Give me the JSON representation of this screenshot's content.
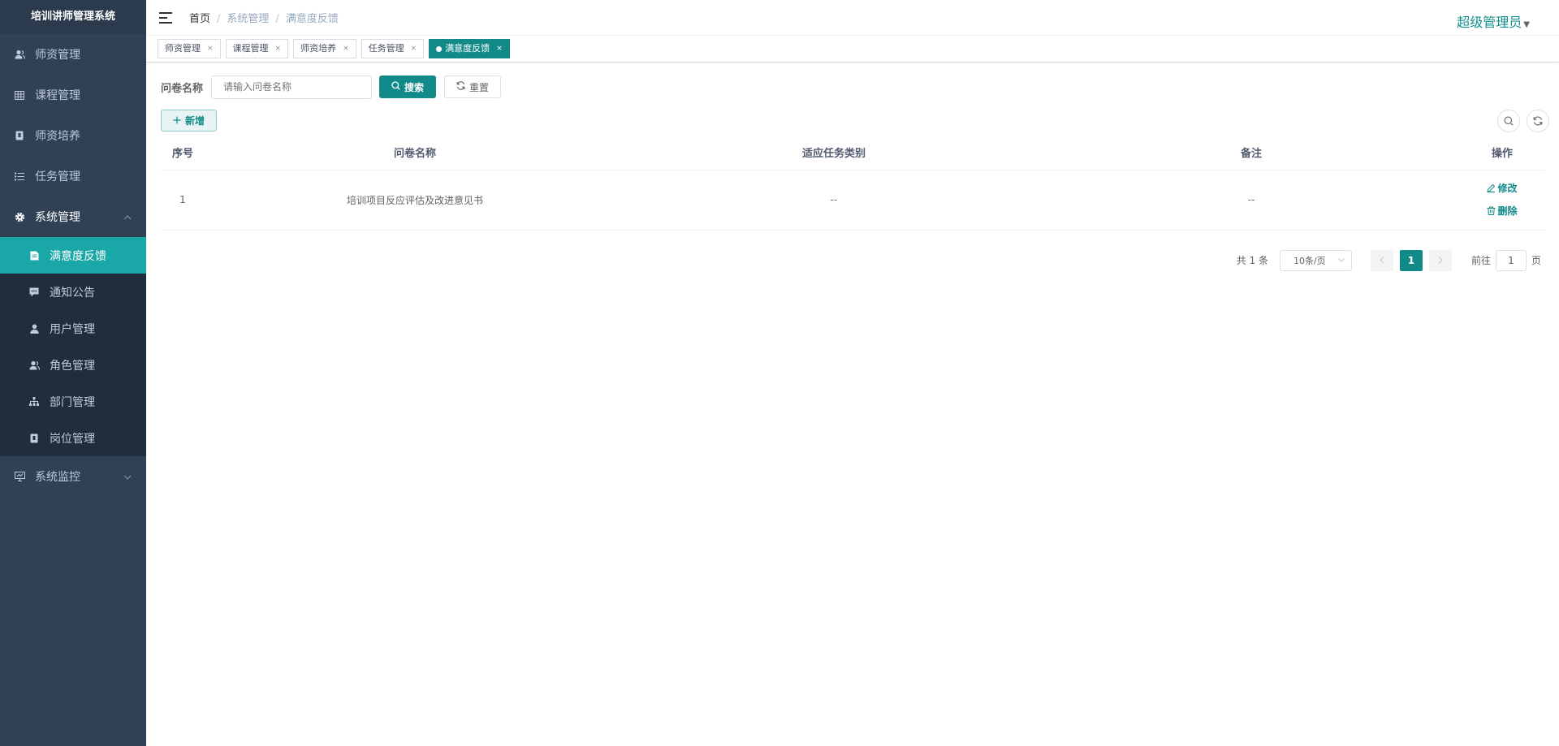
{
  "app": {
    "title": "培训讲师管理系统"
  },
  "sidebar": {
    "items": [
      {
        "label": "师资管理"
      },
      {
        "label": "课程管理"
      },
      {
        "label": "师资培养"
      },
      {
        "label": "任务管理"
      },
      {
        "label": "系统管理"
      }
    ],
    "sub_items": [
      {
        "label": "满意度反馈"
      },
      {
        "label": "通知公告"
      },
      {
        "label": "用户管理"
      },
      {
        "label": "角色管理"
      },
      {
        "label": "部门管理"
      },
      {
        "label": "岗位管理"
      }
    ],
    "monitor": {
      "label": "系统监控"
    }
  },
  "navbar": {
    "breadcrumb": [
      "首页",
      "系统管理",
      "满意度反馈"
    ],
    "user": "超级管理员"
  },
  "tags": [
    "师资管理",
    "课程管理",
    "师资培养",
    "任务管理",
    "满意度反馈"
  ],
  "search": {
    "label": "问卷名称",
    "placeholder": "请输入问卷名称",
    "search_btn": "搜索",
    "reset_btn": "重置"
  },
  "toolbar": {
    "add_btn": "新增"
  },
  "table": {
    "headers": [
      "序号",
      "问卷名称",
      "适应任务类别",
      "备注",
      "操作"
    ],
    "rows": [
      {
        "index": "1",
        "name": "培训项目反应评估及改进意见书",
        "category": "--",
        "remark": "--",
        "edit": "修改",
        "delete": "删除"
      }
    ]
  },
  "pagination": {
    "total": "共 1 条",
    "page_size": "10条/页",
    "current": "1",
    "goto_prefix": "前往",
    "goto_value": "1",
    "goto_suffix": "页"
  },
  "colors": {
    "accent": "#138a8a",
    "sidebar_bg": "#304156",
    "active_item": "#1aa7a7"
  }
}
